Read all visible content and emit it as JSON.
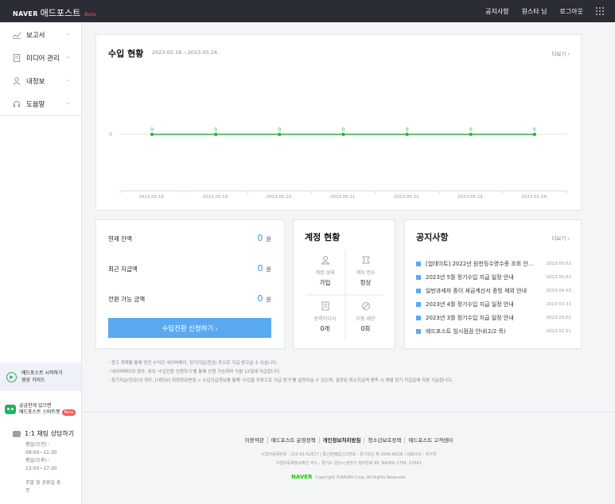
{
  "header": {
    "brand": "NAVER",
    "product": "애드포스트",
    "beta": "Beta",
    "nav": [
      "공지사항",
      "원스타 님",
      "로그아웃"
    ]
  },
  "sidebar": {
    "items": [
      {
        "label": "보고서",
        "icon": "chart-line-icon"
      },
      {
        "label": "미디어 관리",
        "icon": "document-icon"
      },
      {
        "label": "내정보",
        "icon": "user-icon"
      },
      {
        "label": "도움말",
        "icon": "headset-icon"
      }
    ],
    "guide": {
      "line1": "애드포스트 시작하기",
      "line2": "영상 가이드"
    },
    "bot": {
      "line1": "궁금한게 있으면",
      "line2": "애드포스트 스마트봇",
      "badge": "Beta"
    },
    "chat": {
      "title": "1:1 채팅 상담하기",
      "lines": [
        "평일(오전) :",
        "09:00~11:30",
        "평일(오후) :",
        "13:00~17:30",
        "",
        "주말 및 공휴일 휴",
        "무"
      ]
    }
  },
  "income": {
    "title": "수입 현황",
    "range": "2023.05.18.~2023.05.24.",
    "more": "더보기"
  },
  "chart_data": {
    "type": "line",
    "categories": [
      "2023.05.18.",
      "2023.05.19.",
      "2023.05.20.",
      "2023.05.21.",
      "2023.05.22.",
      "2023.05.23.",
      "2023.05.24."
    ],
    "values": [
      0,
      0,
      0,
      0,
      0,
      0,
      0
    ],
    "y_tick_labels": [
      "0"
    ],
    "ylim": [
      0,
      1
    ],
    "line_color": "#2fb34a",
    "grid": false
  },
  "balance": {
    "rows": [
      {
        "label": "현재 잔액",
        "value": "0",
        "unit": "원"
      },
      {
        "label": "최근 지급액",
        "value": "0",
        "unit": "원"
      },
      {
        "label": "전환 가능 금액",
        "value": "0",
        "unit": "원"
      }
    ],
    "button": "수입전환 신청하기  ›"
  },
  "account": {
    "title": "계정 현황",
    "cells": [
      {
        "label": "계정 상태",
        "value": "가입",
        "icon": "person-icon"
      },
      {
        "label": "계좌 번호",
        "value": "정상",
        "icon": "card-icon"
      },
      {
        "label": "등록미디어",
        "value": "0개",
        "icon": "media-icon"
      },
      {
        "label": "이용 제한",
        "value": "0회",
        "icon": "ban-icon"
      }
    ]
  },
  "notice": {
    "title": "공지사항",
    "more": "더보기",
    "items": [
      {
        "title": "[업데이트] 2022년 원천징수영수증 조회 안…",
        "date": "2023.05.02"
      },
      {
        "title": "2023년 5월 정기수입 지급 일정 안내",
        "date": "2023.05.01"
      },
      {
        "title": "일반과세자 종이 세금계산서 증빙 제외 안내",
        "date": "2023.04.03"
      },
      {
        "title": "2023년 4월 정기수입 지급 일정 안내",
        "date": "2023.03.31"
      },
      {
        "title": "2023년 3월 정기수입 지급 일정 안내",
        "date": "2023.03.02"
      },
      {
        "title": "애드포스트 임시점검 안내(2/2 목)",
        "date": "2023.02.01"
      }
    ]
  },
  "notes": [
    "- 광고 게재를 통해 얻은 수익은 네이버페이, 정기지급(현금) 등으로 지급 받으실 수 있습니다.",
    "- 네이버페이의 경우, 위의 '수입전환 신청하기'를 통해 신청 가능하며 익월 12일에 지급됩니다.",
    "- 정기지급(현금)의 경우, [내정보] 회원정보변경 > 수입지급정보를 통해 '수입을 자동으로 지급 받기'를 설정하실 수 있으며, 설정된 최소지급액 충족 시 매월 정기 지급일에 자동 지급됩니다."
  ],
  "footer": {
    "links": [
      "이용약관",
      "애드포스트 운영정책",
      "개인정보처리방침",
      "청소년보호정책",
      "애드포스트 고객센터"
    ],
    "line1": "사업자등록번호 : 220-81-62517  |  통신판매업신고번호 : 경기성남 제 2006-692호  |  대표이사 : 최수연",
    "line2": "사업자등록정보확인 주소 : 경기도 성남시 분당구 정자일로 95, NAVER 1784, 13561",
    "copyright_logo": "NAVER",
    "copyright": "Copyright ©NAVER Corp. All Rights Reserved."
  }
}
